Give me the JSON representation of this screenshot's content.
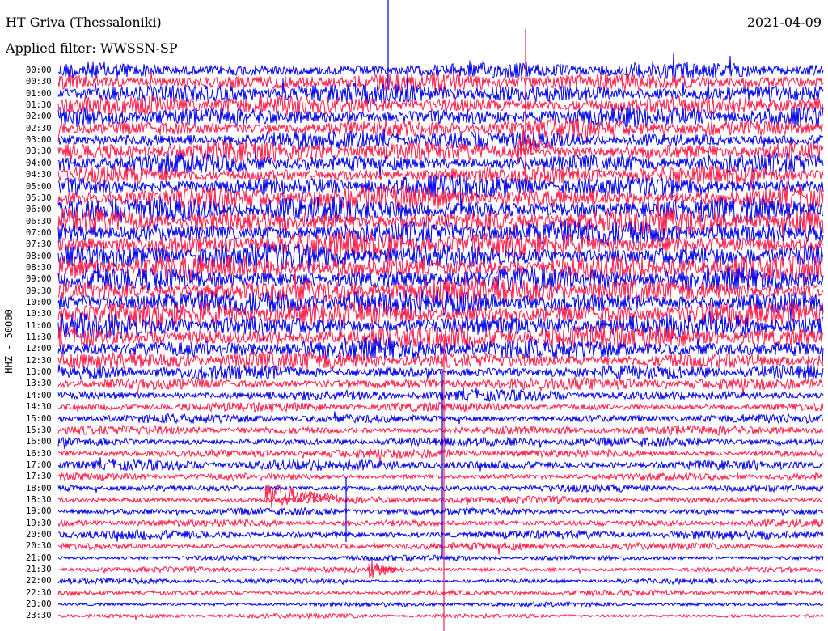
{
  "header": {
    "station": "HT Griva (Thessaloniki)",
    "date": "2021-04-09",
    "filter": "Applied filter: WWSSN-SP"
  },
  "channel_label": "HHZ - 50000",
  "colors": {
    "trace_a": "#0000ee",
    "trace_b": "#ff1f4b",
    "background": "#ffffff"
  },
  "time_labels": [
    "00:00",
    "00:30",
    "01:00",
    "01:30",
    "02:00",
    "02:30",
    "03:00",
    "03:30",
    "04:00",
    "04:30",
    "05:00",
    "05:30",
    "06:00",
    "06:30",
    "07:00",
    "07:30",
    "08:00",
    "08:30",
    "09:00",
    "09:30",
    "10:00",
    "10:30",
    "11:00",
    "11:30",
    "12:00",
    "12:30",
    "13:00",
    "13:30",
    "14:00",
    "14:30",
    "15:00",
    "15:30",
    "16:00",
    "16:30",
    "17:00",
    "17:30",
    "18:00",
    "18:30",
    "19:00",
    "19:30",
    "20:00",
    "20:30",
    "21:00",
    "21:30",
    "22:00",
    "22:30",
    "23:00",
    "23:30"
  ],
  "noise_levels": [
    0.9,
    1.0,
    1.1,
    1.1,
    1.1,
    1.0,
    1.0,
    1.1,
    1.1,
    1.0,
    1.2,
    1.3,
    1.4,
    1.4,
    1.4,
    1.4,
    1.4,
    1.4,
    1.4,
    1.4,
    1.4,
    1.4,
    1.3,
    1.3,
    1.2,
    1.0,
    0.8,
    0.7,
    0.6,
    0.5,
    0.5,
    0.5,
    0.5,
    0.5,
    0.6,
    0.4,
    0.4,
    0.4,
    0.4,
    0.4,
    0.5,
    0.4,
    0.3,
    0.3,
    0.3,
    0.3,
    0.25,
    0.25
  ]
}
